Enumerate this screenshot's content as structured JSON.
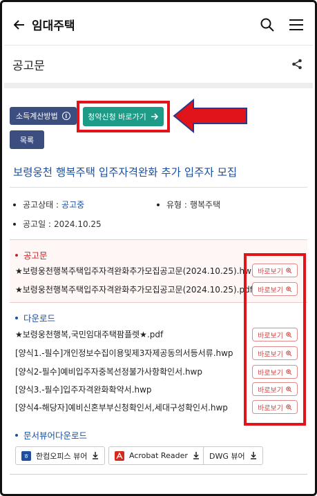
{
  "header": {
    "title": "임대주택",
    "back_icon": "arrow-left-icon",
    "search_icon": "search-icon",
    "menu_icon": "hamburger-icon"
  },
  "section": {
    "title": "공고문",
    "share_icon": "share-icon"
  },
  "buttons": {
    "income_calc": "소득계산방법",
    "apply": "청약신청 바로가기",
    "list": "목록"
  },
  "post": {
    "title": "보령웅천 행복주택 입주자격완화 추가 입주자 모집",
    "status_label": "공고상태 :",
    "status_value": "공고중",
    "type_label": "유형 :",
    "type_value": "행복주택",
    "date_label": "공고일 :",
    "date_value": "2024.10.25"
  },
  "notice": {
    "heading": "공고문",
    "files": [
      "★보령웅천행복주택입주자격완화추가모집공고문(2024.10.25).hwp",
      "★보령웅천행복주택입주자격완화추가모집공고문(2024.10.25).pdf"
    ]
  },
  "download": {
    "heading": "다운로드",
    "files": [
      "★보령웅천행복,국민임대주택팜플렛★.pdf",
      "[양식1.-필수]개인정보수집이용및제3자제공동의서등서류.hwp",
      "[양식2-필수]예비입주자중복선정불가사항확인서.hwp",
      "[양식3.-필수]입주자격완화확약서.hwp",
      "[양식4-해당자]예비신혼부부신청확인서,세대구성확인서.hwp"
    ]
  },
  "view_label": "바로보기",
  "viewers": {
    "heading": "문서뷰어다운로드",
    "items": [
      "한컴오피스 뷰어",
      "Acrobat Reader",
      "DWG 뷰어"
    ]
  },
  "colors": {
    "navy": "#3b4e7f",
    "teal": "#1d9b87",
    "highlight_red": "#e1141a",
    "title_blue": "#1a4fa0"
  }
}
